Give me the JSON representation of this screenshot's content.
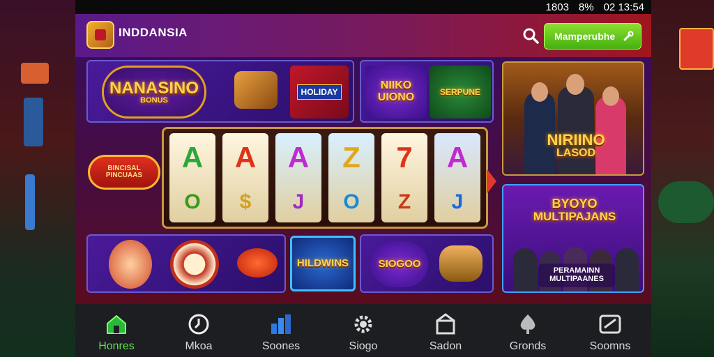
{
  "status_bar": {
    "time": "02 13:54",
    "battery": "8%",
    "signal_text": "1803"
  },
  "app_bar": {
    "brand": "INDDANSIA",
    "cta_label": "Mamperubhe"
  },
  "tiles": {
    "top_left": {
      "logo_text": "NANASINO",
      "logo_sub": "BONUS",
      "badge": "HOLIDAY"
    },
    "top_middle": {
      "left_text": "NIIKO\nUIONO",
      "right_text": "SERPUNE"
    },
    "left_badge": "BINCISAL\nPINCUAAS",
    "reels": [
      {
        "top": "A",
        "bottom": "O",
        "top_color": "#2aa83a",
        "bottom_color": "#3a9a1a"
      },
      {
        "top": "A",
        "bottom": "$",
        "top_color": "#e0321a",
        "bottom_color": "#d4a020"
      },
      {
        "top": "A",
        "bottom": "J",
        "top_color": "#c02ad0",
        "bottom_color": "#a02ac0"
      },
      {
        "top": "Z",
        "bottom": "O",
        "top_color": "#e0a81a",
        "bottom_color": "#1a8ad0"
      },
      {
        "top": "7",
        "bottom": "Z",
        "top_color": "#e0321a",
        "bottom_color": "#c83a1a"
      },
      {
        "top": "A",
        "bottom": "J",
        "top_color": "#c02ad0",
        "bottom_color": "#1a6ae0"
      }
    ],
    "bottom_middle": "HILDWINS",
    "bottom_right": "SIOGOO"
  },
  "banners": {
    "promo_top": {
      "title": "NIRIINO",
      "subtitle": "LASOD"
    },
    "promo_bottom": {
      "title": "BYOYO",
      "subtitle": "MULTIPAJANS",
      "caption_1": "PERAMAINN",
      "caption_2": "MULTIPAANES"
    }
  },
  "nav": [
    {
      "label": "Honres",
      "icon": "home-icon",
      "active": true
    },
    {
      "label": "Mkoa",
      "icon": "clock-icon",
      "active": false
    },
    {
      "label": "Soones",
      "icon": "chart-icon",
      "active": false
    },
    {
      "label": "Siogo",
      "icon": "gear-icon",
      "active": false
    },
    {
      "label": "Sadon",
      "icon": "shop-icon",
      "active": false
    },
    {
      "label": "Gronds",
      "icon": "spade-icon",
      "active": false
    },
    {
      "label": "Soomns",
      "icon": "ticket-icon",
      "active": false
    }
  ],
  "colors": {
    "accent": "#62e04a",
    "cta": "#5cc81e",
    "panel_border": "#6a5ad0"
  }
}
